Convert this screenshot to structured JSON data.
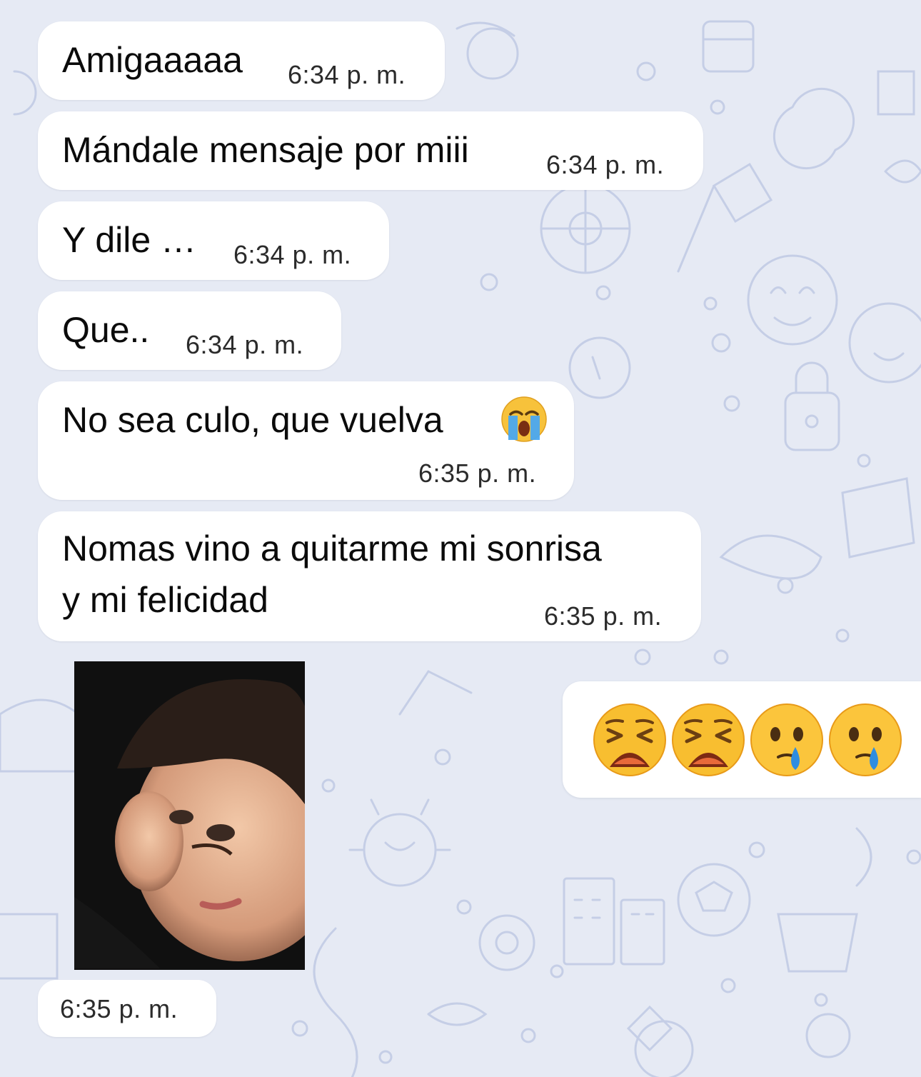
{
  "colors": {
    "background": "#e6eaf4",
    "bubble": "#ffffff",
    "text": "#0b0b0b",
    "doodle": "#c5cee6"
  },
  "messages": [
    {
      "text": "Amigaaaaa",
      "time": "6:34 p. m."
    },
    {
      "text": "Mándale mensaje por miii",
      "time": "6:34 p. m."
    },
    {
      "text": "Y dile …",
      "time": "6:34 p. m."
    },
    {
      "text": "Que..",
      "time": "6:34 p. m."
    },
    {
      "text": "No sea culo, que vuelva",
      "emoji": "loudly-crying-face",
      "time": "6:35 p. m."
    },
    {
      "line1": "Nomas vino a quitarme mi sonrisa",
      "line2": "y mi felicidad",
      "time": "6:35 p. m."
    }
  ],
  "photo_message": {
    "description_icon": "photo-crying-baby",
    "time": "6:35 p. m."
  },
  "reaction_picker": {
    "emojis": [
      "tired-face",
      "tired-face",
      "face-holding-back-tears",
      "face-holding-back-tears"
    ]
  }
}
